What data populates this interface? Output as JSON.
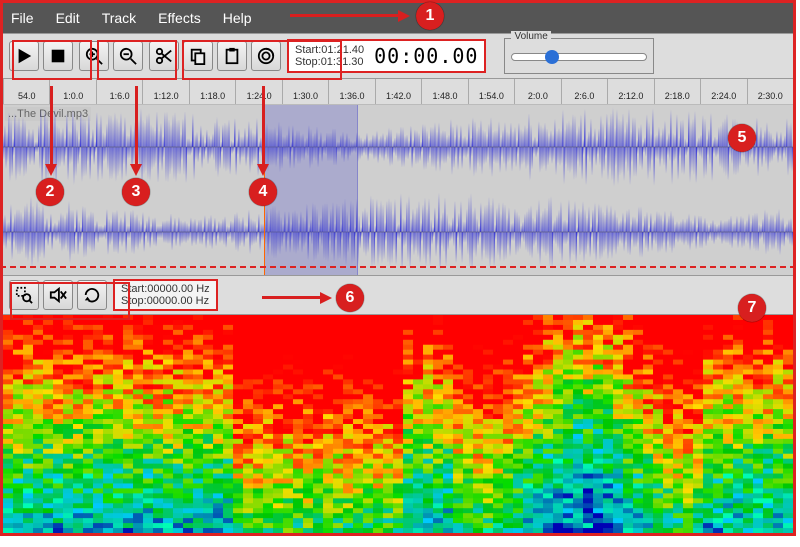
{
  "menu": {
    "file": "File",
    "edit": "Edit",
    "track": "Track",
    "effects": "Effects",
    "help": "Help"
  },
  "toolbar": {
    "play": "Play",
    "stop": "Stop",
    "zoom_in": "Zoom In",
    "zoom_out": "Zoom Out",
    "cut": "Cut",
    "copy": "Copy",
    "paste": "Paste",
    "fx": "Effects"
  },
  "time": {
    "start_label": "Start:",
    "start_val": "01:21.40",
    "stop_label": "Stop:",
    "stop_val": "01:31.30",
    "big": "00:00.00"
  },
  "volume": {
    "label": "Volume"
  },
  "ruler": [
    "54.0",
    "1:0.0",
    "1:6.0",
    "1:12.0",
    "1:18.0",
    "1:24.0",
    "1:30.0",
    "1:36.0",
    "1:42.0",
    "1:48.0",
    "1:54.0",
    "2:0.0",
    "2:6.0",
    "2:12.0",
    "2:18.0",
    "2:24.0",
    "2:30.0"
  ],
  "track": {
    "name": "...The Devil.mp3"
  },
  "low": {
    "zoom": "Zoom Selection",
    "mute": "Mute",
    "loop": "Loop"
  },
  "freq": {
    "start_label": "Start:",
    "start_val": "00000.00 Hz",
    "stop_label": "Stop:",
    "stop_val": "00000.00 Hz"
  },
  "callouts": {
    "c1": "1",
    "c2": "2",
    "c3": "3",
    "c4": "4",
    "c5": "5",
    "c6": "6",
    "c7": "7"
  }
}
